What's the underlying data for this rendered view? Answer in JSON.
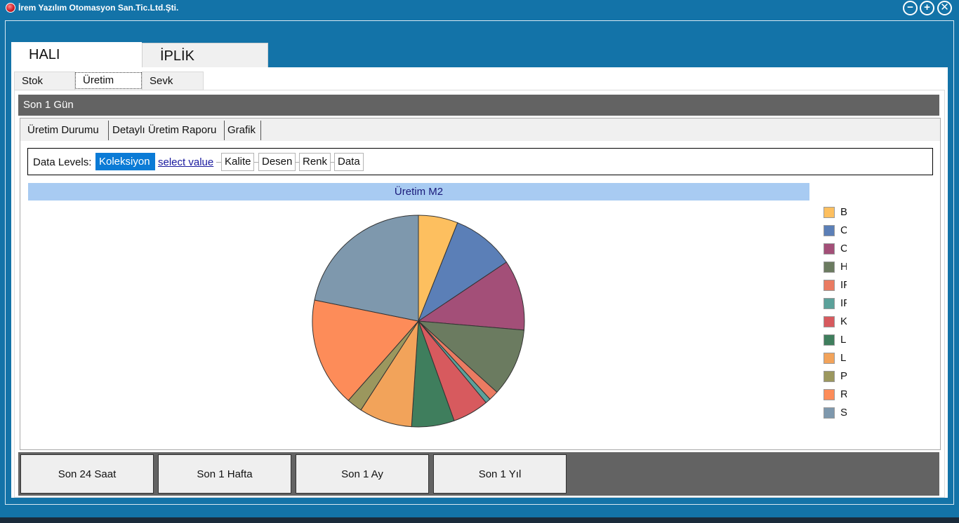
{
  "window": {
    "title": "İrem Yazılım Otomasyon San.Tic.Ltd.Şti.",
    "controls": {
      "minimize": "−",
      "maximize": "+",
      "close": "✕"
    }
  },
  "top_tabs": [
    {
      "label": "HALI",
      "selected": true
    },
    {
      "label": "İPLİK",
      "selected": false
    }
  ],
  "sub_tabs": [
    {
      "label": "Stok",
      "selected": false
    },
    {
      "label": "Üretim",
      "selected": true
    },
    {
      "label": "Sevk",
      "selected": false
    }
  ],
  "period_header": "Son 1 Gün",
  "report_tabs": [
    {
      "label": "Üretim Durumu"
    },
    {
      "label": "Detaylı Üretim Raporu"
    },
    {
      "label": "Grafik",
      "selected": true
    }
  ],
  "data_levels": {
    "label": "Data Levels:",
    "active": "Koleksiyon",
    "select_link": "select value",
    "levels": [
      "Kalite",
      "Desen",
      "Renk",
      "Data"
    ]
  },
  "chart_data": {
    "type": "pie",
    "title": "Üretim M2",
    "legend_position": "right",
    "categories": [
      "B",
      "C",
      "C",
      "H",
      "IF",
      "IF",
      "K",
      "L",
      "L",
      "P",
      "R",
      "S"
    ],
    "values": [
      6.1,
      9.7,
      10.9,
      10.5,
      1.5,
      0.8,
      5.6,
      6.6,
      8.2,
      2.4,
      16.9,
      22.1
    ],
    "colors": [
      "#fdbf5f",
      "#5b7fb7",
      "#a34f78",
      "#6b7b60",
      "#ea7b62",
      "#5ba19a",
      "#d75a5e",
      "#3f7e5d",
      "#f2a35a",
      "#9b975e",
      "#fd8c59",
      "#7e98ad"
    ]
  },
  "period_buttons": [
    "Son 24 Saat",
    "Son 1 Hafta",
    "Son 1 Ay",
    "Son 1 Yıl"
  ]
}
